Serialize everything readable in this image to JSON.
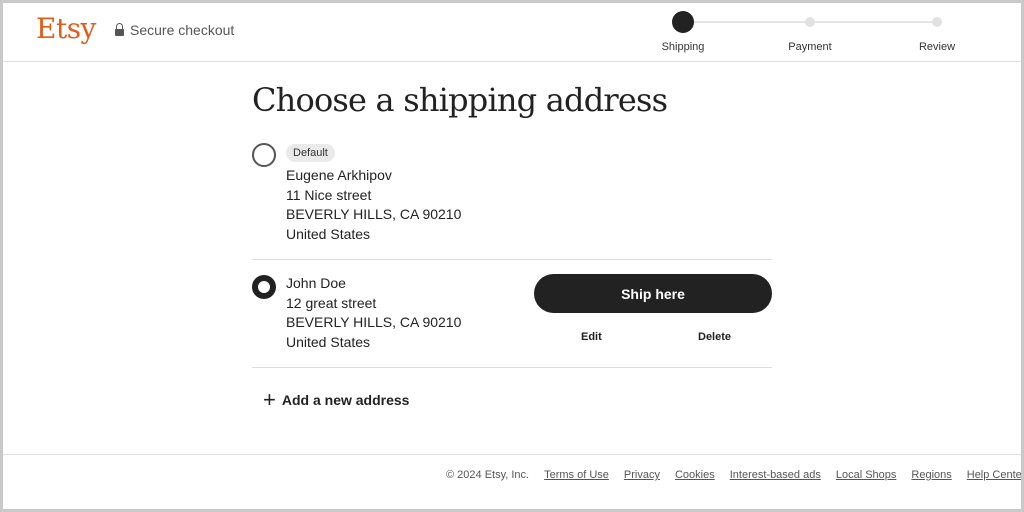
{
  "header": {
    "logo": "Etsy",
    "secure_label": "Secure checkout",
    "steps": [
      {
        "label": "Shipping",
        "active": true
      },
      {
        "label": "Payment",
        "active": false
      },
      {
        "label": "Review",
        "active": false
      }
    ]
  },
  "main": {
    "title": "Choose a shipping address",
    "addresses": [
      {
        "badge": "Default",
        "name": "Eugene Arkhipov",
        "street": "11 Nice street",
        "city": "BEVERLY HILLS, CA 90210",
        "country": "United States",
        "selected": false
      },
      {
        "name": "John Doe",
        "street": "12 great street",
        "city": "BEVERLY HILLS, CA 90210",
        "country": "United States",
        "selected": true
      }
    ],
    "ship_here": "Ship here",
    "edit": "Edit",
    "delete": "Delete",
    "add_new": "Add a new address"
  },
  "footer": {
    "copyright": "© 2024 Etsy, Inc.",
    "links": [
      "Terms of Use",
      "Privacy",
      "Cookies",
      "Interest-based ads",
      "Local Shops",
      "Regions",
      "Help Center"
    ]
  }
}
